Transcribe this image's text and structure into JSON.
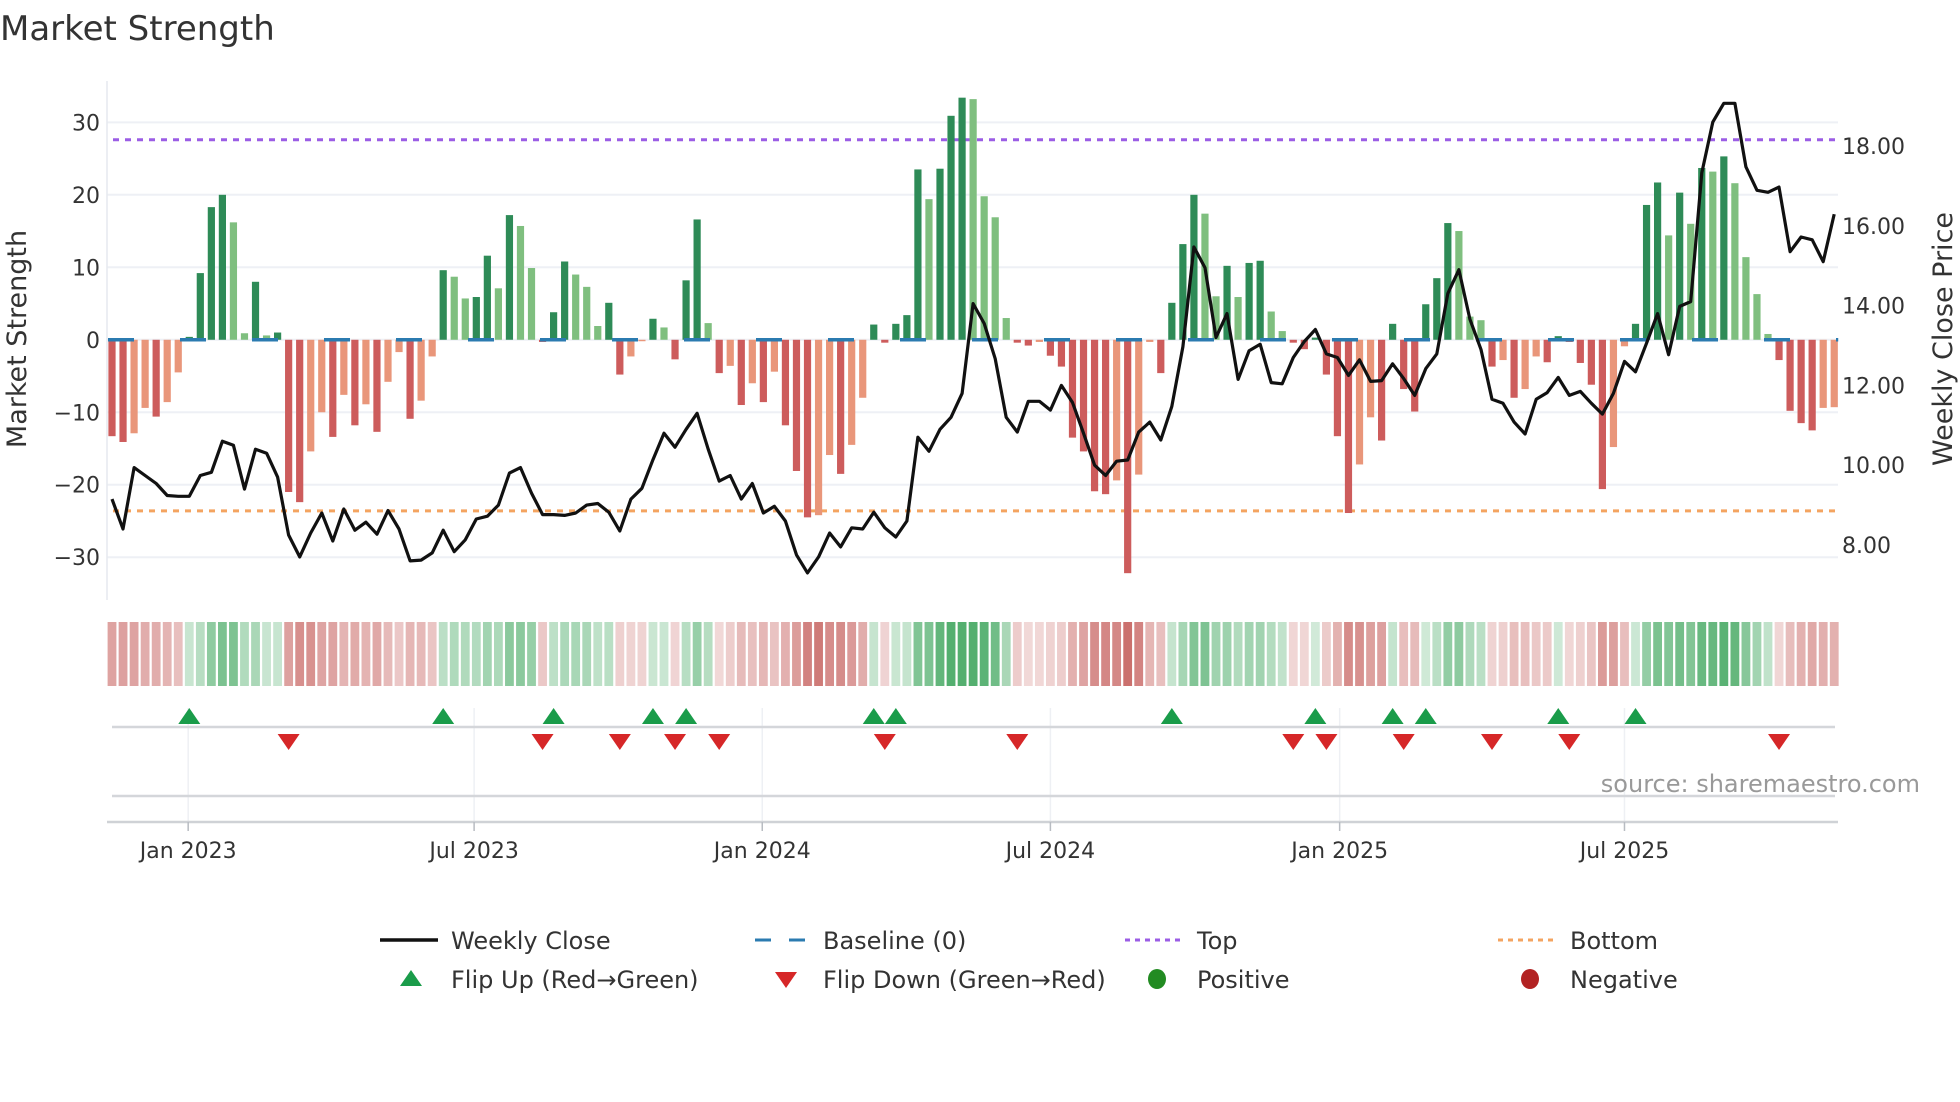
{
  "chart_data": {
    "type": "bar",
    "title": "Market Strength",
    "ylabel": "Market Strength",
    "ylabel_right": "Weekly Close Price",
    "source": "source: sharemaestro.com",
    "ylim": [
      -35.9,
      35.7
    ],
    "ylim_right": [
      6.62,
      19.63
    ],
    "grid": true,
    "y_ticks": [
      {
        "v": 30,
        "label": "30"
      },
      {
        "v": 20,
        "label": "20"
      },
      {
        "v": 10,
        "label": "10"
      },
      {
        "v": 0,
        "label": "0"
      },
      {
        "v": -10,
        "label": "−10"
      },
      {
        "v": -20,
        "label": "−20"
      },
      {
        "v": -30,
        "label": "−30"
      }
    ],
    "y_ticks_right": [
      {
        "v": 8,
        "label": "8.00"
      },
      {
        "v": 10,
        "label": "10.00"
      },
      {
        "v": 12,
        "label": "12.00"
      },
      {
        "v": 14,
        "label": "14.00"
      },
      {
        "v": 16,
        "label": "16.00"
      },
      {
        "v": 18,
        "label": "18.00"
      }
    ],
    "x_ticks": [
      {
        "week": 6.9,
        "label": "Jan 2023"
      },
      {
        "week": 32.8,
        "label": "Jul 2023"
      },
      {
        "week": 58.9,
        "label": "Jan 2024"
      },
      {
        "week": 85.0,
        "label": "Jul 2024"
      },
      {
        "week": 111.2,
        "label": "Jan 2025"
      },
      {
        "week": 137.0,
        "label": "Jul 2025"
      }
    ],
    "top_level": 27.6,
    "bottom_level": -23.6,
    "strength": [
      -13.3,
      -14.1,
      -12.9,
      -9.4,
      -10.6,
      -8.6,
      -4.5,
      0.4,
      9.2,
      18.3,
      20,
      16.2,
      0.9,
      8,
      0.6,
      1,
      -21,
      -22.4,
      -15.4,
      -10,
      -13.4,
      -7.6,
      -11.8,
      -8.9,
      -12.7,
      -5.8,
      -1.7,
      -10.9,
      -8.4,
      -2.3,
      9.6,
      8.7,
      5.7,
      5.9,
      11.6,
      7.1,
      17.2,
      15.7,
      9.9,
      -0.3,
      3.8,
      10.8,
      9,
      7.3,
      1.9,
      5.1,
      -4.8,
      -2.3,
      -0.2,
      2.9,
      1.7,
      -2.7,
      8.2,
      16.6,
      2.3,
      -4.6,
      -3.6,
      -9,
      -6,
      -8.6,
      -4.4,
      -11.8,
      -18.1,
      -24.5,
      -24.2,
      -15.9,
      -18.5,
      -14.5,
      -8,
      2.1,
      -0.4,
      2.2,
      3.4,
      23.5,
      19.4,
      23.6,
      30.9,
      33.4,
      33.2,
      19.8,
      16.9,
      3,
      -0.4,
      -0.8,
      -0.3,
      -2.2,
      -3.7,
      -13.5,
      -15.4,
      -20.9,
      -21.3,
      -19.4,
      -32.2,
      -18.6,
      -0.3,
      -4.6,
      5.1,
      13.2,
      20,
      17.4,
      6,
      10.2,
      5.9,
      10.6,
      10.9,
      3.9,
      1.2,
      -0.4,
      -1.3,
      0.3,
      -4.8,
      -13.3,
      -23.9,
      -17.2,
      -10.7,
      -13.9,
      2.2,
      -6.8,
      -9.9,
      4.9,
      8.5,
      16.1,
      15,
      3.2,
      2.7,
      -3.7,
      -2.8,
      -8,
      -6.8,
      -2.3,
      -3.1,
      0.5,
      -0.3,
      -3.2,
      -6.2,
      -20.6,
      -14.8,
      -0.9,
      2.2,
      18.6,
      21.7,
      14.4,
      20.3,
      16,
      23.7,
      23.2,
      25.3,
      21.6,
      11.4,
      6.3,
      0.8,
      -2.8,
      -9.8,
      -11.5,
      -12.5,
      -9.4,
      -9.3
    ],
    "weekly_close": [
      9.15,
      8.4,
      9.94,
      9.74,
      9.54,
      9.24,
      9.22,
      9.22,
      9.74,
      9.82,
      10.6,
      10.5,
      9.4,
      10.4,
      10.3,
      9.7,
      8.25,
      7.7,
      8.3,
      8.8,
      8.1,
      8.9,
      8.37,
      8.57,
      8.27,
      8.86,
      8.4,
      7.6,
      7.62,
      7.8,
      8.37,
      7.83,
      8.13,
      8.65,
      8.72,
      9.0,
      9.8,
      9.94,
      9.3,
      8.76,
      8.76,
      8.74,
      8.8,
      9.0,
      9.04,
      8.82,
      8.35,
      9.15,
      9.42,
      10.14,
      10.8,
      10.45,
      10.9,
      11.3,
      10.4,
      9.6,
      9.74,
      9.15,
      9.54,
      8.8,
      8.97,
      8.6,
      7.75,
      7.3,
      7.7,
      8.3,
      7.95,
      8.43,
      8.4,
      8.82,
      8.43,
      8.2,
      8.6,
      10.7,
      10.35,
      10.9,
      11.2,
      11.8,
      14.05,
      13.55,
      12.67,
      11.2,
      10.83,
      11.6,
      11.6,
      11.38,
      12.0,
      11.57,
      10.8,
      10.0,
      9.74,
      10.1,
      10.13,
      10.83,
      11.08,
      10.63,
      11.47,
      12.97,
      15.47,
      14.95,
      13.2,
      13.8,
      12.15,
      12.87,
      13.03,
      12.07,
      12.04,
      12.7,
      13.1,
      13.4,
      12.79,
      12.7,
      12.25,
      12.64,
      12.1,
      12.12,
      12.54,
      12.17,
      11.75,
      12.42,
      12.79,
      14.3,
      14.9,
      13.66,
      12.9,
      11.65,
      11.55,
      11.08,
      10.78,
      11.65,
      11.82,
      12.2,
      11.75,
      11.85,
      11.55,
      11.28,
      11.8,
      12.6,
      12.34,
      13.06,
      13.8,
      12.77,
      13.98,
      14.1,
      17.33,
      18.6,
      19.07,
      19.07,
      17.48,
      16.89,
      16.84,
      16.97,
      15.35,
      15.72,
      15.65,
      15.1,
      16.29
    ],
    "flip_up_weeks": [
      7,
      30,
      40,
      49,
      52,
      69,
      71,
      96,
      109,
      116,
      119,
      131,
      138
    ],
    "flip_down_weeks": [
      16,
      39,
      46,
      51,
      55,
      70,
      82,
      107,
      110,
      117,
      125,
      132,
      151
    ],
    "legend": [
      {
        "label": "Weekly Close",
        "icon": "solid-line"
      },
      {
        "label": "Baseline (0)",
        "icon": "dashed-line"
      },
      {
        "label": "Top",
        "icon": "dotted-line"
      },
      {
        "label": "Bottom",
        "icon": "dotted-line"
      },
      {
        "label": "Flip Up (Red→Green)",
        "icon": "triangle-up"
      },
      {
        "label": "Flip Down (Green→Red)",
        "icon": "triangle-down"
      },
      {
        "label": "Positive",
        "icon": "circle"
      },
      {
        "label": "Negative",
        "icon": "circle"
      }
    ],
    "legend_placement": "bottom"
  },
  "colors": {
    "green_strong": "#2e8b57",
    "green_weak": "#7fbf7f",
    "red_strong": "#cd5c5c",
    "red_weak": "#e9967a",
    "close": "#111111",
    "baseline": "#2b7bb0",
    "top": "#9b5de5",
    "bottom": "#f4a460",
    "flip_up": "#1a9c4a",
    "flip_down": "#d62728",
    "positive": "#228b22",
    "negative": "#b22222"
  }
}
